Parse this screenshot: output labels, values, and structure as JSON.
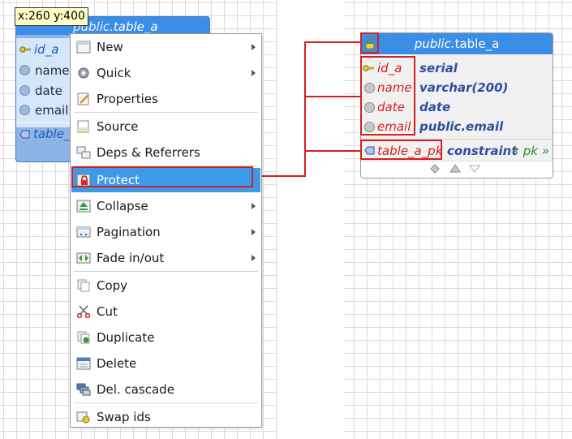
{
  "canvas": {
    "coord_tooltip": "x:260 y:400"
  },
  "left_table": {
    "schema": "public.",
    "name": "table_a",
    "columns": [
      "id_a",
      "name",
      "date",
      "email"
    ],
    "constraint": "table_a"
  },
  "context_menu": {
    "items": [
      {
        "label": "New",
        "icon": "new-object-icon",
        "submenu": true
      },
      {
        "label": "Quick",
        "icon": "quick-action-gear-icon",
        "submenu": true
      },
      {
        "label": "Properties",
        "icon": "properties-edit-icon",
        "submenu": false
      },
      {
        "label": "Source",
        "icon": "sql-source-icon",
        "submenu": false
      },
      {
        "label": "Deps & Referrers",
        "icon": "dependencies-icon",
        "submenu": false
      },
      {
        "label": "Protect",
        "icon": "lock-icon",
        "submenu": false,
        "active": true
      },
      {
        "label": "Collapse",
        "icon": "collapse-icon",
        "submenu": true
      },
      {
        "label": "Pagination",
        "icon": "pagination-icon",
        "submenu": true
      },
      {
        "label": "Fade in/out",
        "icon": "fade-icon",
        "submenu": true
      },
      {
        "label": "Copy",
        "icon": "copy-icon",
        "submenu": false
      },
      {
        "label": "Cut",
        "icon": "scissors-icon",
        "submenu": false
      },
      {
        "label": "Duplicate",
        "icon": "duplicate-icon",
        "submenu": false
      },
      {
        "label": "Delete",
        "icon": "delete-icon",
        "submenu": false
      },
      {
        "label": "Del. cascade",
        "icon": "delete-cascade-icon",
        "submenu": false
      },
      {
        "label": "Swap ids",
        "icon": "swap-ids-icon",
        "submenu": false
      }
    ]
  },
  "right_table": {
    "schema": "public.",
    "name": "table_a",
    "columns": [
      {
        "name": "id_a",
        "type": "serial",
        "icon": "primary-key-icon"
      },
      {
        "name": "name",
        "type": "varchar(200)",
        "icon": "column-circle-icon"
      },
      {
        "name": "date",
        "type": "date",
        "icon": "column-circle-icon"
      },
      {
        "name": "email",
        "type": "public.email",
        "icon": "column-circle-icon"
      }
    ],
    "constraint": {
      "name": "table_a_pk",
      "type": "constraint",
      "tag": "« pk »"
    },
    "protected": true
  },
  "colors": {
    "header_blue": "#3b8ee6",
    "menu_active": "#3d9ae8",
    "highlight_red": "#d32020",
    "column_name": "#d42020",
    "column_type": "#2e4f9e",
    "pk_tag": "#2f8a2f"
  }
}
